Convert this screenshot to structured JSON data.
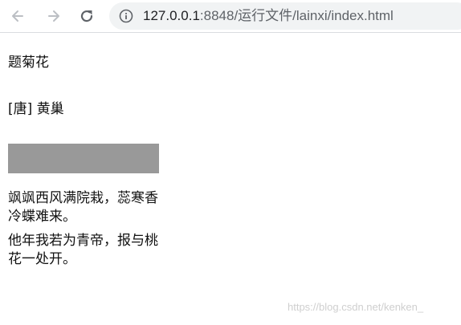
{
  "browser": {
    "url_host": "127.0.0.1",
    "url_rest": ":8848/运行文件/lainxi/index.html",
    "icons": {
      "back": "back-arrow-icon",
      "forward": "forward-arrow-icon",
      "reload": "reload-icon",
      "site_info": "info-icon"
    }
  },
  "page": {
    "title": "题菊花",
    "author": "[唐] 黄巢",
    "block_color": "#999999",
    "lines": [
      "飒飒西风满院栽，蕊寒香冷蝶难来。",
      "他年我若为青帝，报与桃花一处开。"
    ]
  },
  "watermark": "https://blog.csdn.net/kenken_"
}
